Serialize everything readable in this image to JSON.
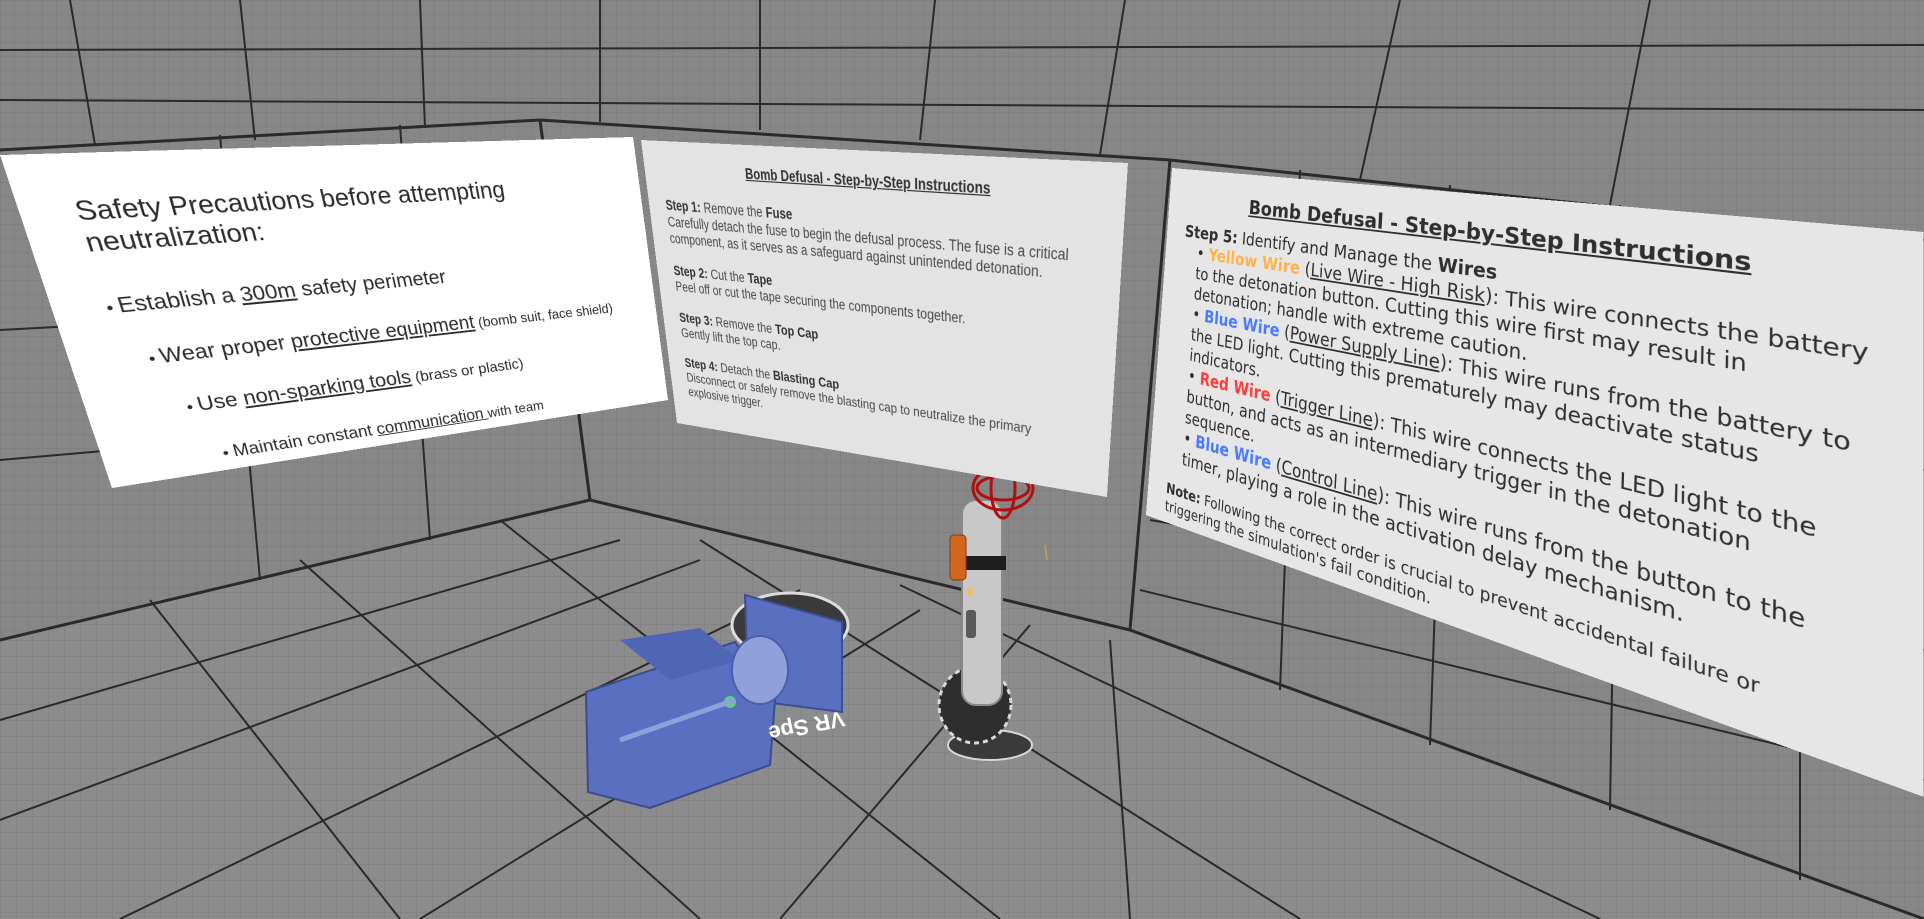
{
  "colors": {
    "wall": "#8a8a8a",
    "grid": "#6e6e6e",
    "corner_line": "#1f1f1f",
    "camera_blue": "#5a6fbf",
    "bomb_body": "#c8c8c8",
    "wire_red": "#c01010",
    "yellow_wire": "#ffb347",
    "blue_wire": "#4a7bff",
    "red_wire": "#ff3b3b"
  },
  "safety_panel": {
    "title": "Safety Precautions before attempting neutralization:",
    "items": [
      {
        "pre": "Establish a ",
        "em": "300m",
        "post": " safety perimeter"
      },
      {
        "pre": "Wear proper ",
        "em": "protective equipment",
        "post": " (bomb suit, face shield)"
      },
      {
        "pre": "Use ",
        "em": "non-sparking tools",
        "post": " (brass or plastic)"
      },
      {
        "pre": "Maintain constant ",
        "em": "communication ",
        "post": "with team"
      }
    ]
  },
  "steps_panel_1": {
    "title": "Bomb Defusal - Step-by-Step Instructions",
    "steps": [
      {
        "label": "Step 1:",
        "action": "Remove the ",
        "target": "Fuse",
        "desc": "Carefully detach the fuse to begin the defusal process. The fuse is a critical component, as it serves as a safeguard against unintended detonation."
      },
      {
        "label": "Step 2:",
        "action": "Cut the ",
        "target": "Tape",
        "desc": "Peel off or cut the tape securing the components together."
      },
      {
        "label": "Step 3:",
        "action": "Remove the ",
        "target": "Top Cap",
        "desc": "Gently lift the top cap."
      },
      {
        "label": "Step 4:",
        "action": "Detach the ",
        "target": "Blasting Cap",
        "desc": "Disconnect or safely remove the blasting cap to neutralize the primary explosive trigger."
      }
    ]
  },
  "steps_panel_2": {
    "title": "Bomb Defusal - Step-by-Step Instructions",
    "step_label": "Step 5:",
    "step_text": " Identify and Manage the ",
    "step_target": "Wires",
    "wires": [
      {
        "name": "Yellow Wire",
        "style": "ylw",
        "role": "Live Wire - High Risk",
        "desc": ": This wire connects the battery to the detonation button. Cutting this wire first may result in detonation; handle with extreme caution."
      },
      {
        "name": "Blue Wire",
        "style": "blu",
        "role": "Power Supply Line",
        "desc": ": This wire runs from the battery to the LED light. Cutting this prematurely may deactivate status indicators."
      },
      {
        "name": "Red Wire",
        "style": "red",
        "role": "Trigger Line",
        "desc": ": This wire connects the LED light to the button, and acts as an intermediary trigger in the detonation sequence."
      },
      {
        "name": "Blue Wire",
        "style": "blu",
        "role": "Control Line",
        "desc": ": This wire runs from the button to the timer, playing a role in the activation delay mechanism."
      }
    ],
    "note_label": "Note:",
    "note_text": " Following the correct order is crucial to prevent accidental failure or triggering the simulation's fail condition."
  },
  "floor_label": "VR Spe"
}
